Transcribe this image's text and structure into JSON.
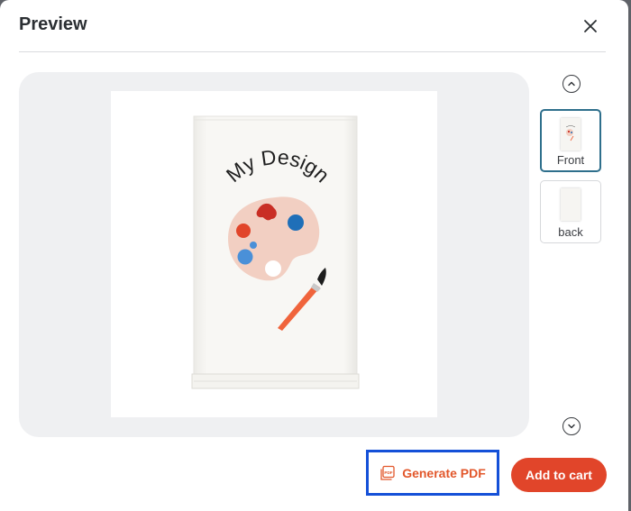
{
  "modal": {
    "title": "Preview",
    "close_icon": "close-icon"
  },
  "preview": {
    "design_text": "My Design",
    "product": "tea towel"
  },
  "thumbnails": {
    "scroll_up_icon": "chevron-up-icon",
    "scroll_down_icon": "chevron-down-icon",
    "items": [
      {
        "label": "Front",
        "selected": true
      },
      {
        "label": "back",
        "selected": false
      }
    ]
  },
  "footer": {
    "pdf_label": "Generate PDF",
    "pdf_icon": "pdf-icon",
    "cart_label": "Add to cart"
  },
  "colors": {
    "accent": "#e1452a",
    "pdf_text": "#e2572b",
    "highlight_border": "#1450d8",
    "selected_thumb_border": "#2e6f8c",
    "stage_bg": "#eff0f2"
  }
}
